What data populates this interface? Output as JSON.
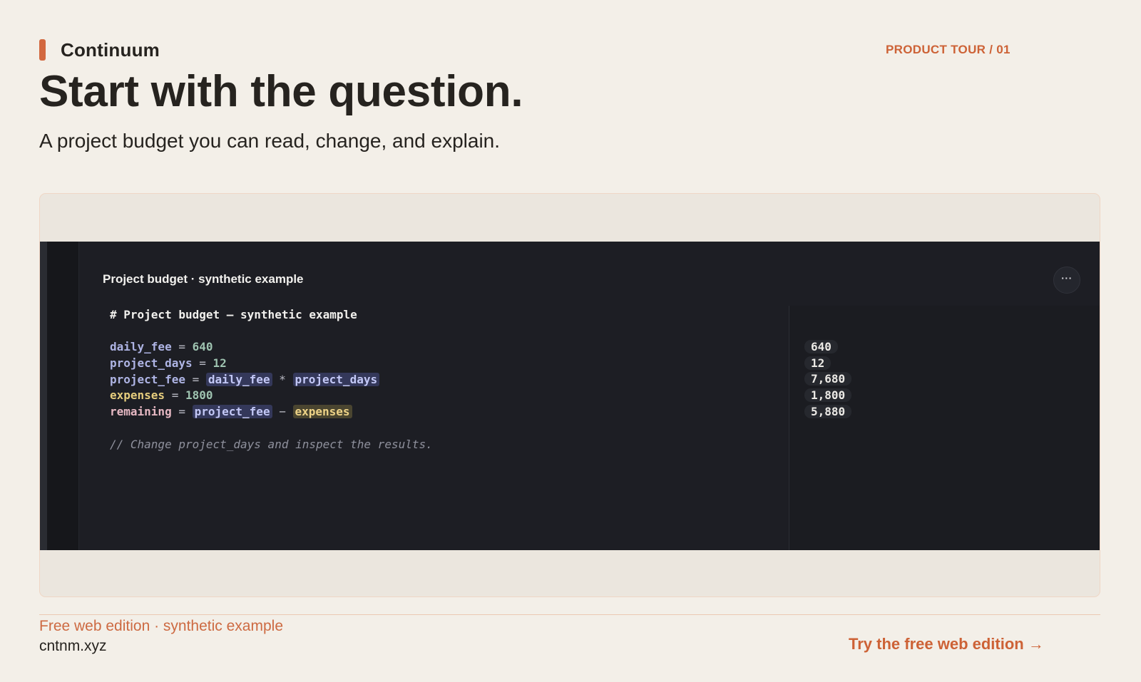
{
  "brand": {
    "name": "Continuum",
    "accent_color": "#d2683f"
  },
  "header": {
    "tour_label": "PRODUCT TOUR / 01",
    "headline": "Start with the question.",
    "subhead": "A project budget you can read, change, and explain."
  },
  "editor": {
    "document_title": "Project budget · synthetic example",
    "more_button_label": "···",
    "heading_comment": "# Project budget — synthetic example",
    "lines": [
      {
        "name": "daily_fee",
        "value": "640"
      },
      {
        "name": "project_days",
        "value": "12"
      },
      {
        "name": "project_fee",
        "refs": [
          "daily_fee",
          "project_days"
        ],
        "operator": "*"
      },
      {
        "name": "expenses",
        "value": "1800"
      },
      {
        "name": "remaining",
        "refs": [
          "project_fee",
          "expenses"
        ],
        "operator": "−"
      }
    ],
    "footer_comment": "// Change project_days and inspect the results.",
    "results": [
      "640",
      "12",
      "7,680",
      "1,800",
      "5,880"
    ]
  },
  "footer": {
    "note": "Free web edition · synthetic example",
    "domain": "cntnm.xyz",
    "cta_label": "Try the free web edition →"
  }
}
